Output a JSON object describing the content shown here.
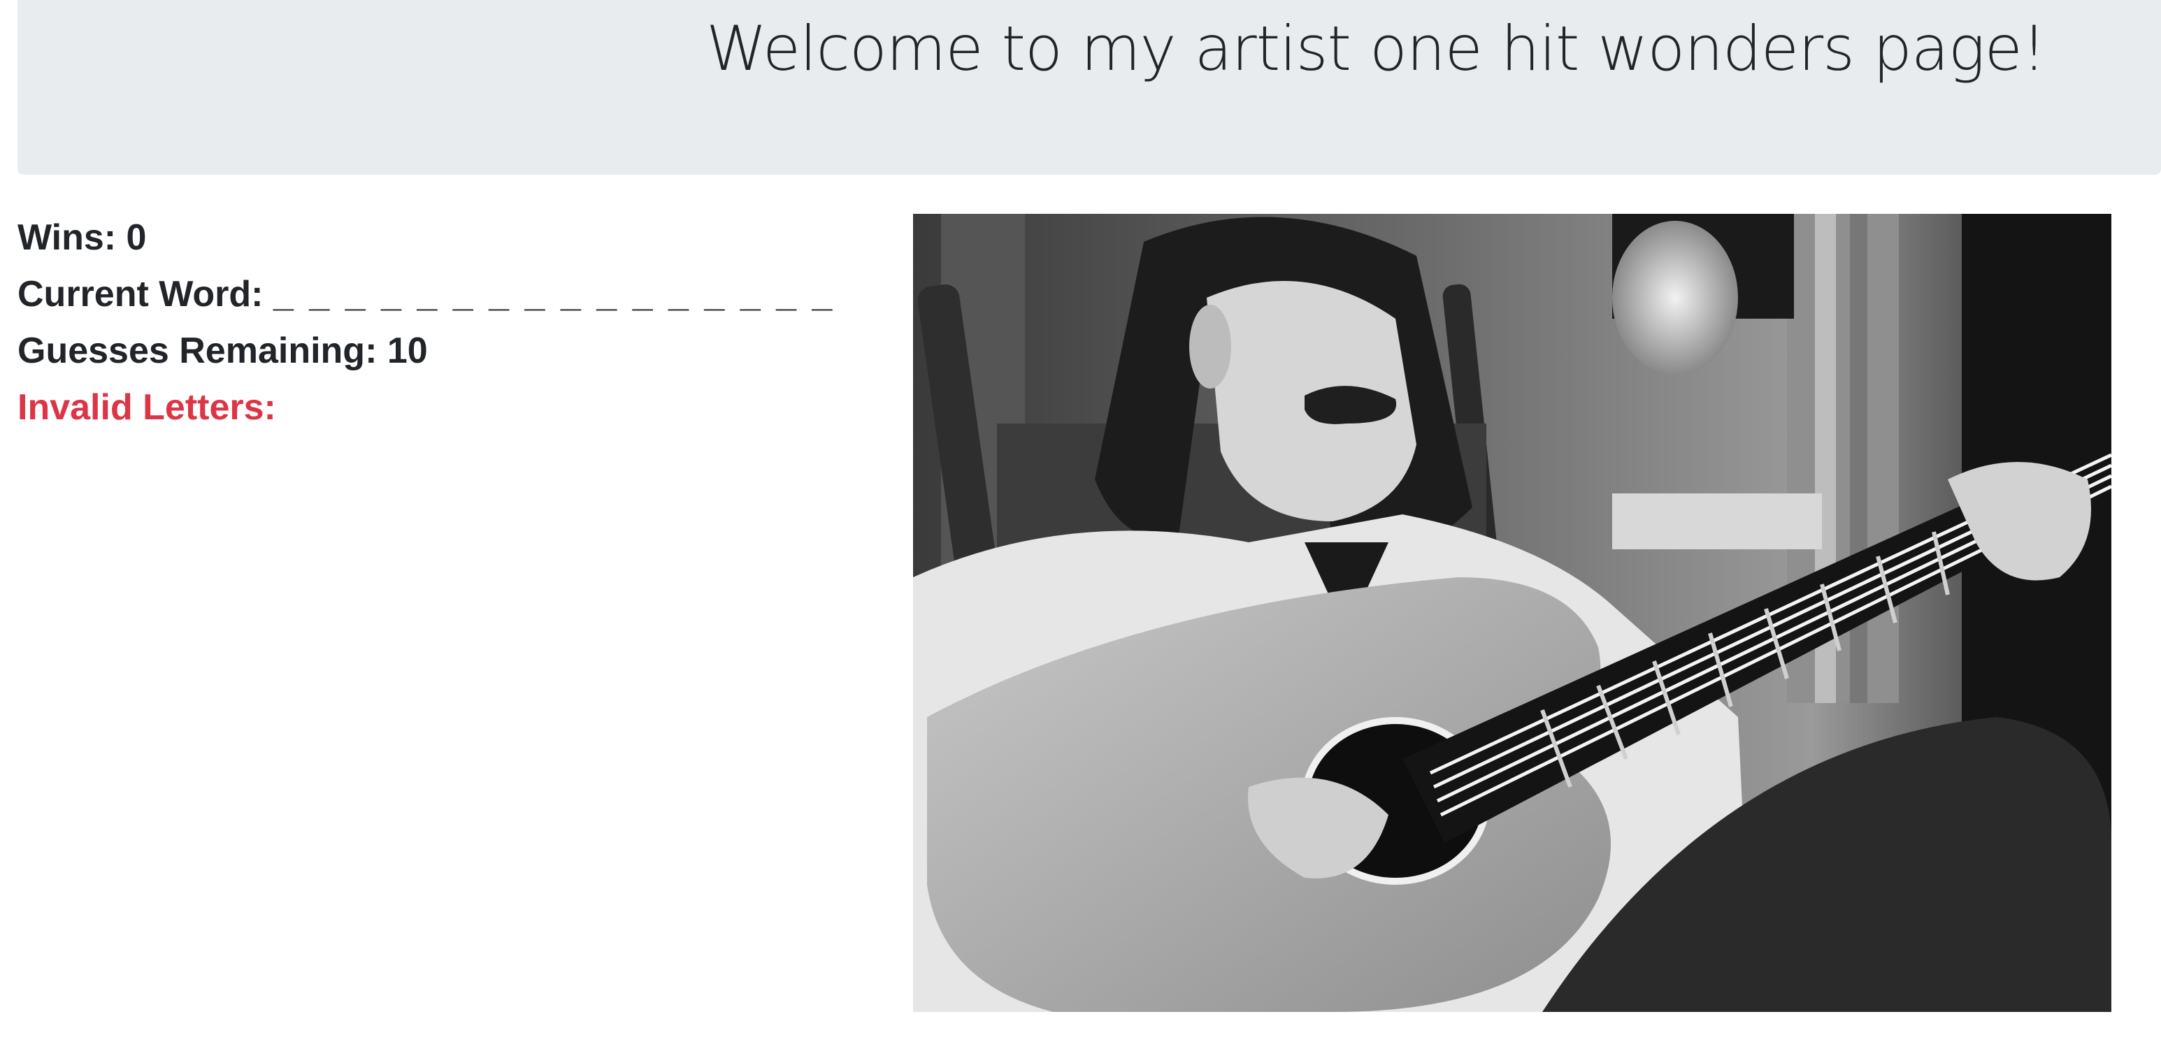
{
  "header": {
    "title": "Welcome to my artist one hit wonders page!"
  },
  "game": {
    "wins_label": "Wins:",
    "wins": "0",
    "current_word_label": "Current Word:",
    "current_word": "_ _ _ _ _ _ _ _ _ _ _ _ _ _ _ _",
    "guesses_label": "Guesses Remaining:",
    "guesses_remaining": "10",
    "invalid_label": "Invalid Letters:",
    "invalid_letters": ""
  },
  "image": {
    "subject": "guitarist-photo",
    "style": "black-and-white"
  },
  "colors": {
    "jumbotron_bg": "#e9ecef",
    "text": "#212529",
    "danger": "#dc3545"
  }
}
